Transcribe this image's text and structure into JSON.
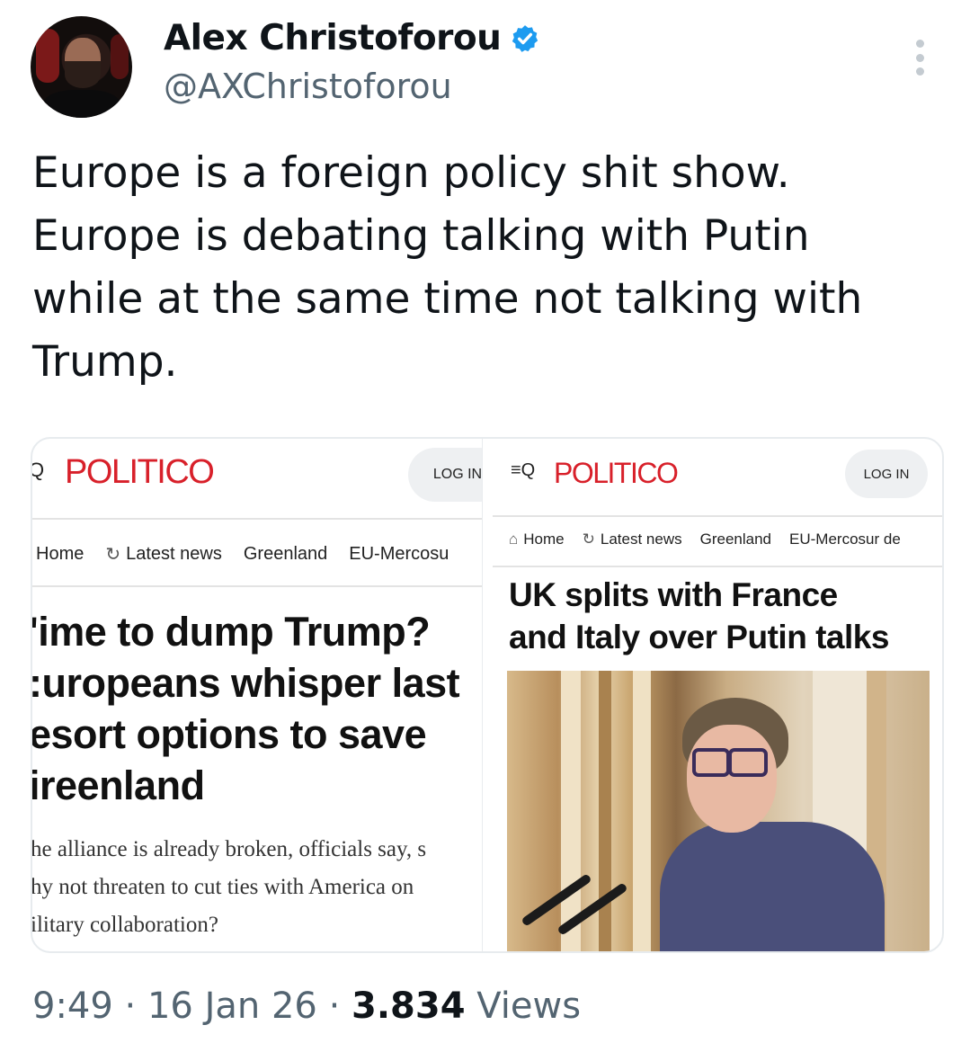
{
  "author": {
    "name": "Alex Christoforou",
    "handle": "@AXChristoforou",
    "verified": true,
    "verified_color": "#1d9bf0"
  },
  "tweet": {
    "text": "Europe is a foreign policy shit show.\nEurope is debating talking with Putin\nwhile at the same time not talking with\nTrump."
  },
  "card_left": {
    "logo": "POLITICO",
    "search_glyph": "Q",
    "login": "LOG IN",
    "nav": [
      "Home",
      "Latest news",
      "Greenland",
      "EU-Mercosu"
    ],
    "headline_lines": [
      "'ime to dump Trump?",
      ":uropeans whisper last",
      "esort options to save",
      "ireenland"
    ],
    "dek_lines": [
      "he alliance is already broken, officials say, s",
      "hy not threaten to cut ties with America on",
      "ilitary collaboration?"
    ]
  },
  "card_right": {
    "logo": "POLITICO",
    "menu_glyph": "≡Q",
    "login": "LOG IN",
    "nav": [
      "Home",
      "Latest news",
      "Greenland",
      "EU-Mercosur de"
    ],
    "headline_lines": [
      "UK splits with France",
      "and Italy over Putin talks"
    ]
  },
  "meta": {
    "time": "9:49",
    "date": "16 Jan 26",
    "views_count": "3.834",
    "views_label": "Views",
    "separator": "·"
  },
  "colors": {
    "politico_red": "#d8202a",
    "muted": "#536471"
  }
}
